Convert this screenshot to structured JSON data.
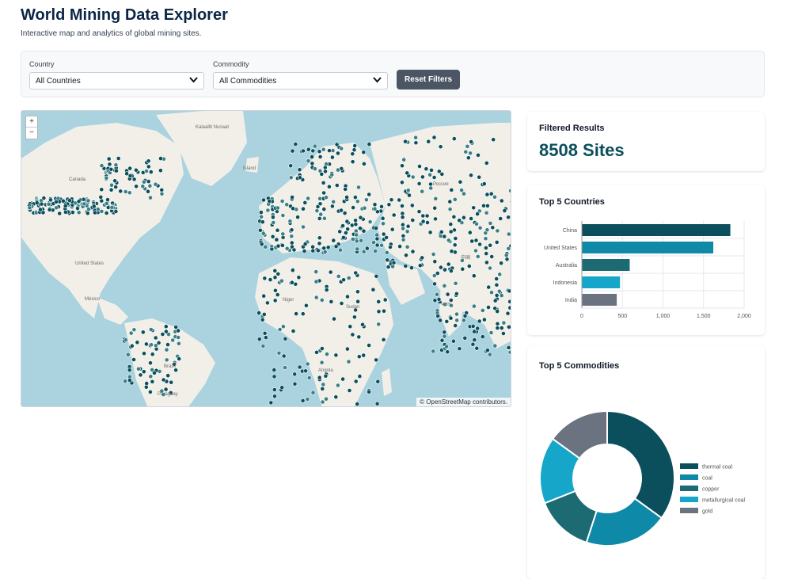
{
  "header": {
    "title": "World Mining Data Explorer",
    "subtitle": "Interactive map and analytics of global mining sites."
  },
  "filters": {
    "country_label": "Country",
    "country_value": "All Countries",
    "commodity_label": "Commodity",
    "commodity_value": "All Commodities",
    "reset_label": "Reset Filters"
  },
  "map": {
    "zoom_in": "+",
    "zoom_out": "−",
    "attribution": "© OpenStreetMap contributors.",
    "labels": {
      "greenland": "Kalaallit Nunaat",
      "canada": "Canada",
      "iceland": "Ísland",
      "usa": "United States",
      "mexico": "México",
      "brazil": "Brasil",
      "paraguay": "Paraguay",
      "africa_1": "Niger",
      "africa_2": "Sudan",
      "angola": "Angola",
      "russia": "Россия",
      "china": "中国",
      "india": "भारत"
    },
    "marker_color": "#0b4f5c"
  },
  "results": {
    "title": "Filtered Results",
    "count": "8508 Sites"
  },
  "chart_data": [
    {
      "type": "bar",
      "title": "Top 5 Countries",
      "orientation": "horizontal",
      "categories": [
        "China",
        "United States",
        "Australia",
        "Indonesia",
        "India"
      ],
      "values": [
        1830,
        1620,
        590,
        470,
        430
      ],
      "colors": [
        "#0b4f5c",
        "#0e8aa8",
        "#1c6b73",
        "#16a6c9",
        "#6b7280"
      ],
      "xlim": [
        0,
        2000
      ],
      "ticks": [
        "0",
        "500",
        "1,000",
        "1,500",
        "2,000"
      ],
      "grid": true
    },
    {
      "type": "pie",
      "title": "Top 5 Commodities",
      "donut": true,
      "categories": [
        "thermal coal",
        "coal",
        "copper",
        "metallurgical coal",
        "gold"
      ],
      "values": [
        35,
        20,
        14,
        16,
        15
      ],
      "colors": [
        "#0b4f5c",
        "#0e8aa8",
        "#1c6b73",
        "#16a6c9",
        "#6b7280"
      ],
      "legend": "right"
    }
  ]
}
